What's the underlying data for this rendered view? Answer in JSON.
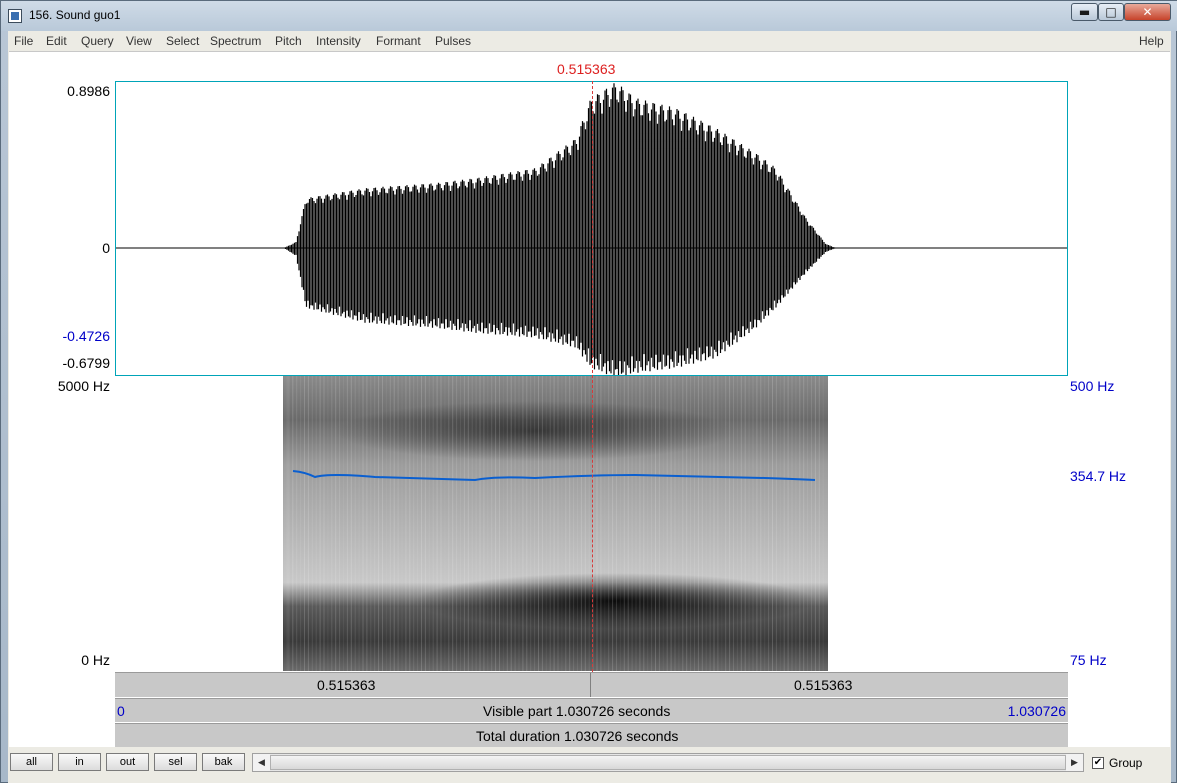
{
  "window": {
    "title": "156. Sound guo1",
    "minimize_glyph": "▬",
    "maximize_glyph": "□",
    "close_glyph": "✕"
  },
  "menu": {
    "items": [
      "File",
      "Edit",
      "Query",
      "View",
      "Select",
      "Spectrum",
      "Pitch",
      "Intensity",
      "Formant",
      "Pulses"
    ],
    "help": "Help"
  },
  "editor": {
    "cursor_time": "0.515363",
    "waveform": {
      "y_max": "0.8986",
      "y_zero": "0",
      "y_marker": "-0.4726",
      "y_min": "-0.6799"
    },
    "spectrogram": {
      "freq_top": "5000 Hz",
      "freq_bottom": "0 Hz",
      "pitch_top": "500 Hz",
      "pitch_value": "354.7 Hz",
      "pitch_bottom": "75 Hz",
      "pitch_curve_color": "#0a5fd0"
    },
    "time_bar": {
      "left_segment": "0.515363",
      "right_segment": "0.515363"
    },
    "visible_bar": {
      "start": "0",
      "label": "Visible part 1.030726 seconds",
      "end": "1.030726"
    },
    "total_bar": {
      "label": "Total duration 1.030726 seconds"
    }
  },
  "bottombar": {
    "buttons": [
      "all",
      "in",
      "out",
      "sel",
      "bak"
    ],
    "scroll_left": "◀",
    "scroll_right": "▶",
    "group_label": "Group",
    "group_checked": "✔"
  }
}
